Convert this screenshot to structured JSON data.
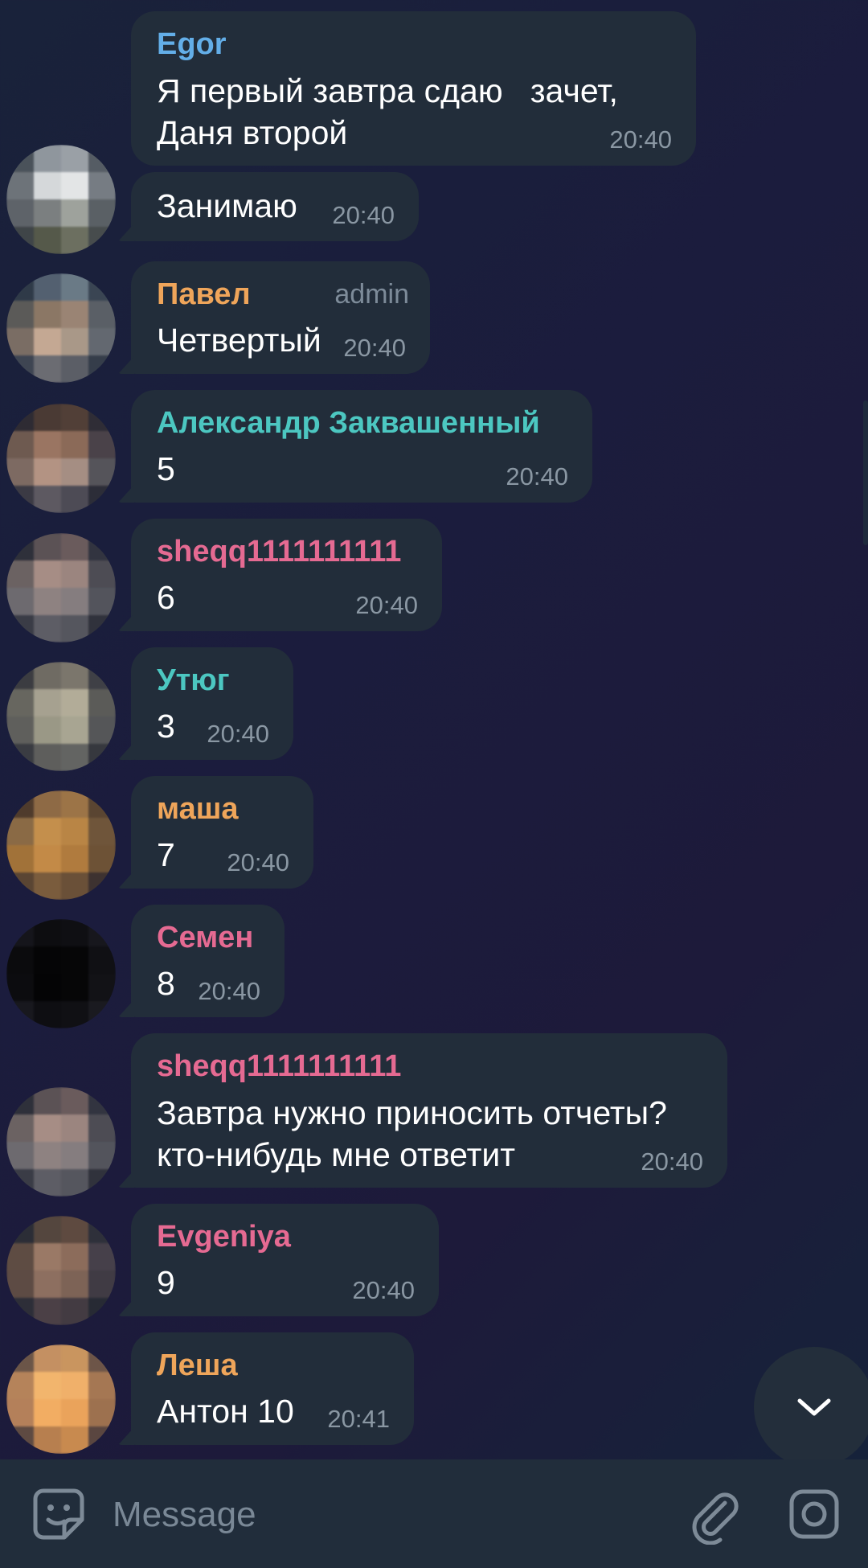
{
  "messages": [
    {
      "sender": "Egor",
      "sender_color": "#63aee8",
      "text": "Я первый завтра сдаю   зачет,\nДаня второй",
      "time": "20:40",
      "avatar": null
    },
    {
      "sender": "",
      "sender_color": "",
      "text": "Занимаю",
      "time": "20:40",
      "avatar": "a1"
    },
    {
      "sender": "Павел",
      "sender_color": "#efa55a",
      "role": "admin",
      "text": "Четвертый",
      "time": "20:40",
      "avatar": "a2"
    },
    {
      "sender": "Александр Заквашенный",
      "sender_color": "#4cc7c1",
      "text": "5",
      "time": "20:40",
      "avatar": "a3"
    },
    {
      "sender": "sheqq1111111111",
      "sender_color": "#e56a92",
      "text": "6",
      "time": "20:40",
      "avatar": "a4"
    },
    {
      "sender": "Утюг",
      "sender_color": "#4cc7c1",
      "text": "3",
      "time": "20:40",
      "avatar": "a5"
    },
    {
      "sender": "маша",
      "sender_color": "#efa55a",
      "text": "7",
      "time": "20:40",
      "avatar": "a6"
    },
    {
      "sender": "Семен",
      "sender_color": "#e56a92",
      "text": "8",
      "time": "20:40",
      "avatar": "a7"
    },
    {
      "sender": "sheqq1111111111",
      "sender_color": "#e56a92",
      "text": "Завтра нужно приносить отчеты?\nкто-нибудь мне ответит",
      "time": "20:40",
      "avatar": "a4"
    },
    {
      "sender": "Evgeniya",
      "sender_color": "#e56a92",
      "text": "9",
      "time": "20:40",
      "avatar": "a8"
    },
    {
      "sender": "Леша",
      "sender_color": "#efa55a",
      "text": "Антон 10",
      "time": "20:41",
      "avatar": "a9"
    }
  ],
  "input": {
    "placeholder": "Message",
    "value": ""
  },
  "icons": {
    "emoji": "sticker-smile-icon",
    "attach": "paperclip-icon",
    "camera": "instagram-camera-icon",
    "scroll": "chevron-down-icon"
  },
  "colors": {
    "bubble": "#222d3a",
    "time": "#8a97a3",
    "bottom_bar": "#212d3b"
  }
}
